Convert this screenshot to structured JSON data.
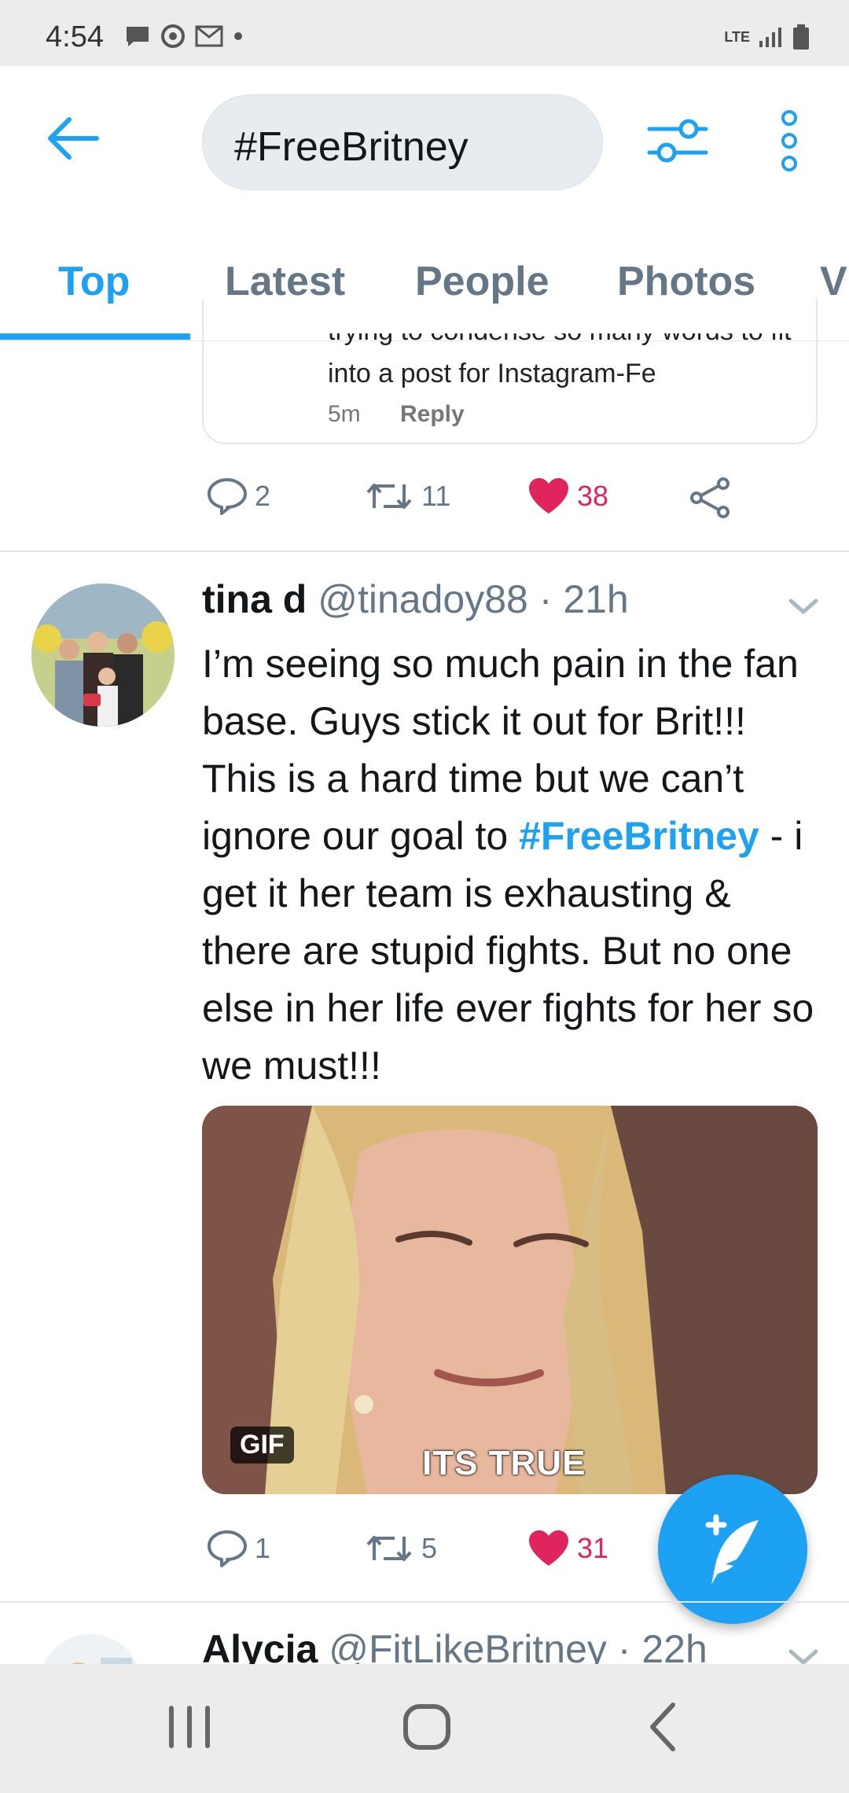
{
  "status_bar": {
    "time": "4:54",
    "network": "LTE"
  },
  "search": {
    "query": "#FreeBritney"
  },
  "tabs": [
    "Top",
    "Latest",
    "People",
    "Photos",
    "V"
  ],
  "quoted_card": {
    "partial_line": "trying to condense so many words to fit",
    "line": "into a post for Instagram-Fe",
    "time": "5m",
    "reply_label": "Reply"
  },
  "prev_tweet_actions": {
    "replies": "2",
    "retweets": "11",
    "likes": "38"
  },
  "tweet": {
    "name": "tina d",
    "handle": "@tinadoy88",
    "separator": "·",
    "time": "21h",
    "text_before": "I’m seeing so much pain in the fan base. Guys stick it out for Brit!!! This is a hard time but we can’t ignore our goal to ",
    "hashtag": "#FreeBritney",
    "text_after": " - i get it her team is exhausting & there are stupid fights. But no one else in her life ever fights for her so we must!!!",
    "media": {
      "badge": "GIF",
      "caption": "ITS TRUE"
    },
    "actions": {
      "replies": "1",
      "retweets": "5",
      "likes": "31"
    }
  },
  "next_tweet": {
    "name": "Alycia",
    "handle": "@FitLikeBritney",
    "separator": "·",
    "time": "22h"
  },
  "colors": {
    "accent": "#1da1f2",
    "like": "#e0245e",
    "muted": "#657786"
  }
}
